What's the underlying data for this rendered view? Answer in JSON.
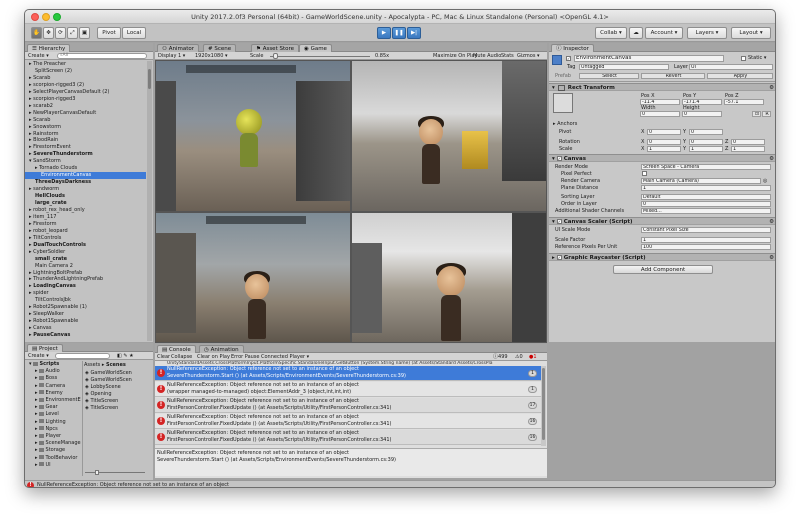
{
  "window": {
    "title": "Unity 2017.2.0f3 Personal (64bit) - GameWorldScene.unity - Apocalypta - PC, Mac & Linux Standalone (Personal) <OpenGL 4.1>"
  },
  "toolbar": {
    "pivot": "Pivot",
    "local": "Local",
    "collab": "Collab ▾",
    "account": "Account ▾",
    "layers": "Layers",
    "layout": "Layout"
  },
  "hierarchy": {
    "tab": "Hierarchy",
    "create": "Create ▾",
    "search_placeholder": "⌕All",
    "items": [
      {
        "label": "▸ The Preacher",
        "indent": 0,
        "bold": false
      },
      {
        "label": "SplitScreen (2)",
        "indent": 1,
        "bold": false
      },
      {
        "label": "▸ Scarab",
        "indent": 0,
        "bold": false
      },
      {
        "label": "▸ scorpion-rigged3 (2)",
        "indent": 0,
        "bold": false
      },
      {
        "label": "▸ SelectPlayerCanvasDefault (2)",
        "indent": 0,
        "bold": false
      },
      {
        "label": "▸ scorpion-rigged3",
        "indent": 0,
        "bold": false
      },
      {
        "label": "▸ scarab2",
        "indent": 0,
        "bold": false
      },
      {
        "label": "▸ NewPlayerCanvasDefault",
        "indent": 0,
        "bold": false
      },
      {
        "label": "▸ Scarab",
        "indent": 0,
        "bold": false
      },
      {
        "label": "▸ Snowstorm",
        "indent": 0,
        "bold": false
      },
      {
        "label": "▸ Rainstorm",
        "indent": 0,
        "bold": false
      },
      {
        "label": "▸ BloodRain",
        "indent": 0,
        "bold": false
      },
      {
        "label": "▸ FirestormEvent",
        "indent": 0,
        "bold": false
      },
      {
        "label": "▸ SevereThunderstorm",
        "indent": 0,
        "bold": true
      },
      {
        "label": "▾ SandStorm",
        "indent": 0,
        "bold": false
      },
      {
        "label": "▸ Tornado Clouds",
        "indent": 1,
        "bold": false
      },
      {
        "label": "EnvironmentCanvas",
        "indent": 2,
        "bold": false,
        "selected": true
      },
      {
        "label": "ThreeDaysDarkness",
        "indent": 1,
        "bold": true
      },
      {
        "label": "▸ sandworm",
        "indent": 0,
        "bold": false
      },
      {
        "label": "HellClouds",
        "indent": 1,
        "bold": true
      },
      {
        "label": "large_crate",
        "indent": 1,
        "bold": true
      },
      {
        "label": "▸ robot_rex_head_only",
        "indent": 0,
        "bold": false
      },
      {
        "label": "▸ item_117",
        "indent": 0,
        "bold": false
      },
      {
        "label": "▸ Firestorm",
        "indent": 0,
        "bold": false
      },
      {
        "label": "▸ robot_leopard",
        "indent": 0,
        "bold": false
      },
      {
        "label": "▸ TiltControls",
        "indent": 0,
        "bold": false
      },
      {
        "label": "▸ DualTouchControls",
        "indent": 0,
        "bold": true
      },
      {
        "label": "▸ CyberSoldier",
        "indent": 0,
        "bold": false
      },
      {
        "label": "small_crate",
        "indent": 1,
        "bold": true
      },
      {
        "label": "Main Camera 2",
        "indent": 1,
        "bold": false
      },
      {
        "label": "▸ LightningBoltPrefab",
        "indent": 0,
        "bold": false
      },
      {
        "label": "▸ ThunderAndLightningPrefab",
        "indent": 0,
        "bold": false
      },
      {
        "label": "▸ LoadingCanvas",
        "indent": 0,
        "bold": true
      },
      {
        "label": "▸ spider",
        "indent": 0,
        "bold": false
      },
      {
        "label": "TiltControlsJbk",
        "indent": 1,
        "bold": false
      },
      {
        "label": "▸ Robot2Spawnable (1)",
        "indent": 0,
        "bold": false
      },
      {
        "label": "▸ SleepWalker",
        "indent": 0,
        "bold": false
      },
      {
        "label": "▸ Robot1Spawnable",
        "indent": 0,
        "bold": false
      },
      {
        "label": "▸ Canvas",
        "indent": 0,
        "bold": false
      },
      {
        "label": "▸ PauseCanvas",
        "indent": 0,
        "bold": true
      }
    ]
  },
  "center_tabs": [
    {
      "label": "Animator",
      "active": false
    },
    {
      "label": "Scene",
      "active": false
    },
    {
      "label": "Asset Store",
      "active": false
    },
    {
      "label": "Game",
      "active": true
    }
  ],
  "game_bar": {
    "display": "Display 1 ▾",
    "resolution": "1920x1080 ▾",
    "scale_label": "Scale",
    "scale_value": "0.85x",
    "maximize": "Maximize On Play",
    "mute": "Mute Audio",
    "stats": "Stats",
    "gizmos": "Gizmos ▾"
  },
  "inspector": {
    "tab": "Inspector",
    "object_name": "EnvironmentCanvas",
    "static": "Static ▾",
    "tag_label": "Tag",
    "tag_value": "Untagged",
    "layer_label": "Layer",
    "layer_value": "UI",
    "prefab_label": "Prefab",
    "prefab_select": "Select",
    "prefab_revert": "Revert",
    "prefab_apply": "Apply",
    "rect": {
      "title": "Rect Transform",
      "pos_x_label": "Pos X",
      "pos_y_label": "Pos Y",
      "pos_z_label": "Pos Z",
      "pos_x": "-11.4",
      "pos_y": "-171.4",
      "pos_z": "-57.1",
      "width_label": "Width",
      "height_label": "Height",
      "width": "0",
      "height": "0",
      "anchors": "Anchors",
      "pivot_label": "Pivot",
      "pivot_x": "0",
      "pivot_y": "0",
      "rotation_label": "Rotation",
      "rot_x": "0",
      "rot_y": "0",
      "rot_z": "0",
      "scale_label": "Scale",
      "scale_x": "1",
      "scale_y": "1",
      "scale_z": "1",
      "x": "X",
      "y": "Y",
      "z": "Z",
      "r_btn": "R"
    },
    "canvas": {
      "title": "Canvas",
      "render_mode_label": "Render Mode",
      "render_mode": "Screen Space - Camera",
      "pixel_perfect_label": "Pixel Perfect",
      "render_camera_label": "Render Camera",
      "render_camera": "Main Camera (Camera)",
      "plane_distance_label": "Plane Distance",
      "plane_distance": "1",
      "sorting_layer_label": "Sorting Layer",
      "sorting_layer": "Default",
      "order_label": "Order in Layer",
      "order": "0",
      "shader_label": "Additional Shader Channels",
      "shader": "Mixed..."
    },
    "scaler": {
      "title": "Canvas Scaler (Script)",
      "mode_label": "UI Scale Mode",
      "mode": "Constant Pixel Size",
      "scale_factor_label": "Scale Factor",
      "scale_factor": "1",
      "ref_label": "Reference Pixels Per Unit",
      "ref": "100"
    },
    "raycaster": {
      "title": "Graphic Raycaster (Script)"
    },
    "add_component": "Add Component"
  },
  "project": {
    "tab": "Project",
    "create": "Create ▾",
    "tree": [
      "Scripts",
      "Audio",
      "Boss",
      "Camera",
      "Enemy",
      "EnvironmentE",
      "Gear",
      "Level",
      "Lighting",
      "Npcs",
      "Player",
      "SceneManage",
      "Storage",
      "ToolBehavior",
      "UI"
    ],
    "breadcrumb_a": "Assets ▸",
    "breadcrumb_b": "Scenes",
    "assets": [
      "GameWorldScen",
      "GameWorldScen",
      "LobbyScene",
      "Opening",
      "TitleScreen",
      "TitleScreen"
    ]
  },
  "console": {
    "tab_console": "Console",
    "tab_animation": "Animation",
    "clear": "Clear",
    "collapse": "Collapse",
    "clear_on_play": "Clear on Play",
    "error_pause": "Error Pause",
    "player": "Connected Player ▾",
    "counts": {
      "log": "499",
      "warn": "0",
      "error": "1"
    },
    "top_line": "UnityStandardAssets.CrossPlatformInput.PlatformSpecific.StandaloneInput.GetButton (System.String name) (at Assets/Standard Assets/CrossPla",
    "messages": [
      {
        "line1": "NullReferenceException: Object reference not set to an instance of an object",
        "line2": "SevereThunderstorm.Start () (at Assets/Scripts/EnvironmentEvents/SevereThunderstorm.cs:39)",
        "count": "1",
        "selected": true
      },
      {
        "line1": "NullReferenceException: Object reference not set to an instance of an object",
        "line2": "(wrapper managed-to-managed) object:ElementAddr_3 (object,int,int,int)",
        "count": "1",
        "selected": false
      },
      {
        "line1": "NullReferenceException: Object reference not set to an instance of an object",
        "line2": "FirstPersonController.FixedUpdate () (at Assets/Scripts/Utility/FirstPersonController.cs:341)",
        "count": "17",
        "selected": false
      },
      {
        "line1": "NullReferenceException: Object reference not set to an instance of an object",
        "line2": "FirstPersonController.FixedUpdate () (at Assets/Scripts/Utility/FirstPersonController.cs:341)",
        "count": "16",
        "selected": false
      },
      {
        "line1": "NullReferenceException: Object reference not set to an instance of an object",
        "line2": "FirstPersonController.FixedUpdate () (at Assets/Scripts/Utility/FirstPersonController.cs:341)",
        "count": "16",
        "selected": false
      }
    ],
    "detail_line1": "NullReferenceException: Object reference not set to an instance of an object",
    "detail_line2": "SevereThunderstorm.Start () (at Assets/Scripts/EnvironmentEvents/SevereThunderstorm.cs:39)"
  },
  "statusbar": {
    "text": "NullReferenceException: Object reference not set to an instance of an object"
  },
  "colors": {
    "selection": "#3e7bd8",
    "error": "#d42424",
    "play_blue": "#3a78c0",
    "panel": "#c2c2c2"
  }
}
